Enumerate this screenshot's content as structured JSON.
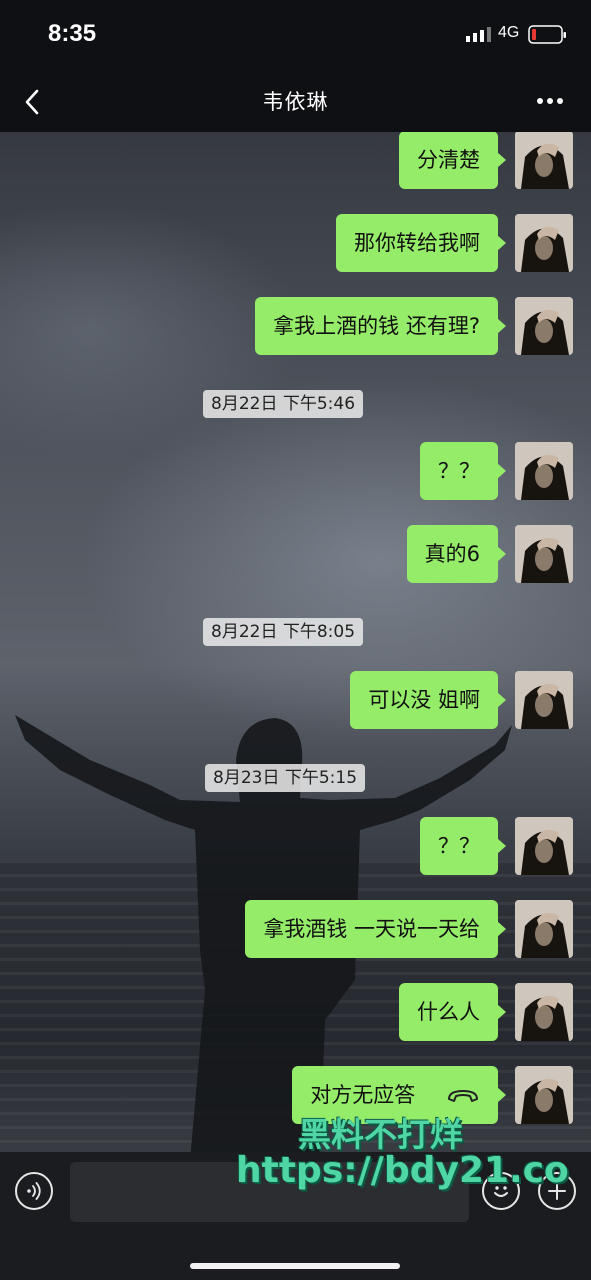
{
  "status_bar": {
    "time": "8:35",
    "network": "4G",
    "icons": [
      "signal-icon",
      "battery-icon"
    ]
  },
  "nav": {
    "title": "韦依琳",
    "back_icon": "chevron-left-icon",
    "more_icon": "more-dots-icon"
  },
  "messages": [
    {
      "type": "sent",
      "text": "分清楚"
    },
    {
      "type": "sent",
      "text": "那你转给我啊"
    },
    {
      "type": "sent",
      "text": "拿我上酒的钱 还有理?"
    },
    {
      "type": "time",
      "text": "8月22日 下午5:46"
    },
    {
      "type": "sent",
      "text": "？？"
    },
    {
      "type": "sent",
      "text": "真的6"
    },
    {
      "type": "time",
      "text": "8月22日 下午8:05"
    },
    {
      "type": "sent",
      "text": "可以没 姐啊"
    },
    {
      "type": "time",
      "text": "8月23日 下午5:15"
    },
    {
      "type": "sent",
      "text": "？？"
    },
    {
      "type": "sent",
      "text": "拿我酒钱 一天说一天给"
    },
    {
      "type": "sent",
      "text": "什么人"
    },
    {
      "type": "sent",
      "text": "对方无应答",
      "icon": "phone-hangup-icon"
    }
  ],
  "input_bar": {
    "message_value": "",
    "icons": [
      "voice-icon",
      "emoji-icon",
      "plus-icon"
    ]
  },
  "watermark": {
    "line1": "黑料不打烊",
    "line2": "https://bdy21.co"
  },
  "colors": {
    "bubble_sent": "#95ec69",
    "bar_background": "#0f1013",
    "watermark": "#4fd6a4"
  }
}
